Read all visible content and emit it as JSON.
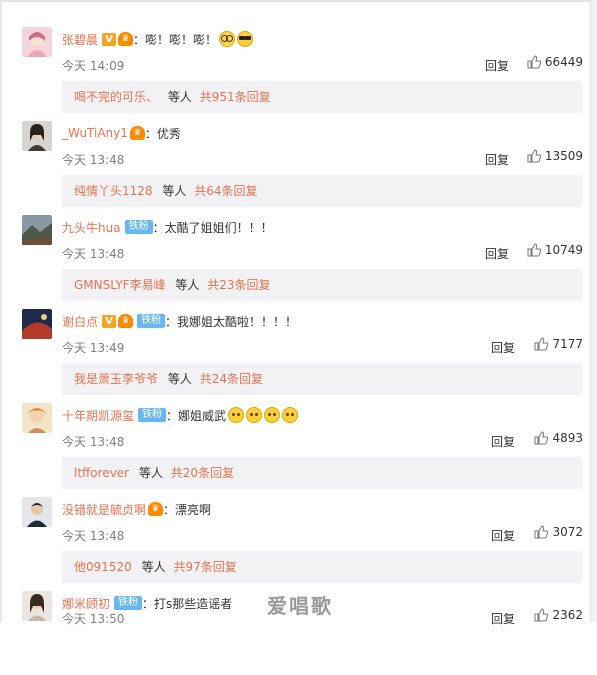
{
  "watermark": "爱唱歌",
  "reply_label": "回复",
  "comments": [
    {
      "user": "张碧晨",
      "badges": [
        "v",
        "crown"
      ],
      "text": "：嘭！嘭！嘭！",
      "emojis": [
        "glasses",
        "cool"
      ],
      "time": "今天 14:09",
      "likes": "66449",
      "sub_user": "喝不完的可乐、",
      "sub_mid": "等人",
      "sub_count": "共951条回复"
    },
    {
      "user": "_WuTiAny1",
      "badges": [
        "crown"
      ],
      "text": "：优秀",
      "emojis": [],
      "time": "今天 13:48",
      "likes": "13509",
      "sub_user": "纯情丫头1128",
      "sub_mid": "等人",
      "sub_count": "共64条回复"
    },
    {
      "user": "九头牛hua",
      "badges": [
        "fan"
      ],
      "fan_label": "铁粉",
      "text": "：太酷了姐姐们！！！",
      "emojis": [],
      "time": "今天 13:48",
      "likes": "10749",
      "sub_user": "GMNSLYF李易峰",
      "sub_mid": "等人",
      "sub_count": "共23条回复"
    },
    {
      "user": "谢白点",
      "badges": [
        "v",
        "crown",
        "fan"
      ],
      "fan_label": "铁粉",
      "text": "：我娜姐太酷啦！！！！",
      "emojis": [],
      "time": "今天 13:49",
      "likes": "7177",
      "sub_user": "我是萧玉李爷爷",
      "sub_mid": "等人",
      "sub_count": "共24条回复"
    },
    {
      "user": "十年期凯源玺",
      "badges": [
        "fan"
      ],
      "fan_label": "铁粉",
      "text": "：娜姐威武",
      "emojis": [
        "smile",
        "smile",
        "smile",
        "smile"
      ],
      "time": "今天 13:48",
      "likes": "4893",
      "sub_user": "ltfforever",
      "sub_mid": "等人",
      "sub_count": "共20条回复"
    },
    {
      "user": "没错就是毓贞啊",
      "badges": [
        "crown"
      ],
      "text": "：漂亮啊",
      "emojis": [],
      "time": "今天 13:48",
      "likes": "3072",
      "sub_user": "他091520",
      "sub_mid": "等人",
      "sub_count": "共97条回复"
    },
    {
      "user": "娜米顾初",
      "badges": [
        "fan"
      ],
      "fan_label": "铁粉",
      "text": "：打s那些造谣者",
      "emojis": [],
      "time": "今天 13:50",
      "likes": "2362",
      "sub_user": "",
      "sub_mid": "",
      "sub_count": ""
    }
  ],
  "colors": {
    "username": "#eb7350",
    "fan_badge": "#67b7f0",
    "subbox_bg": "#f2f2f5"
  }
}
